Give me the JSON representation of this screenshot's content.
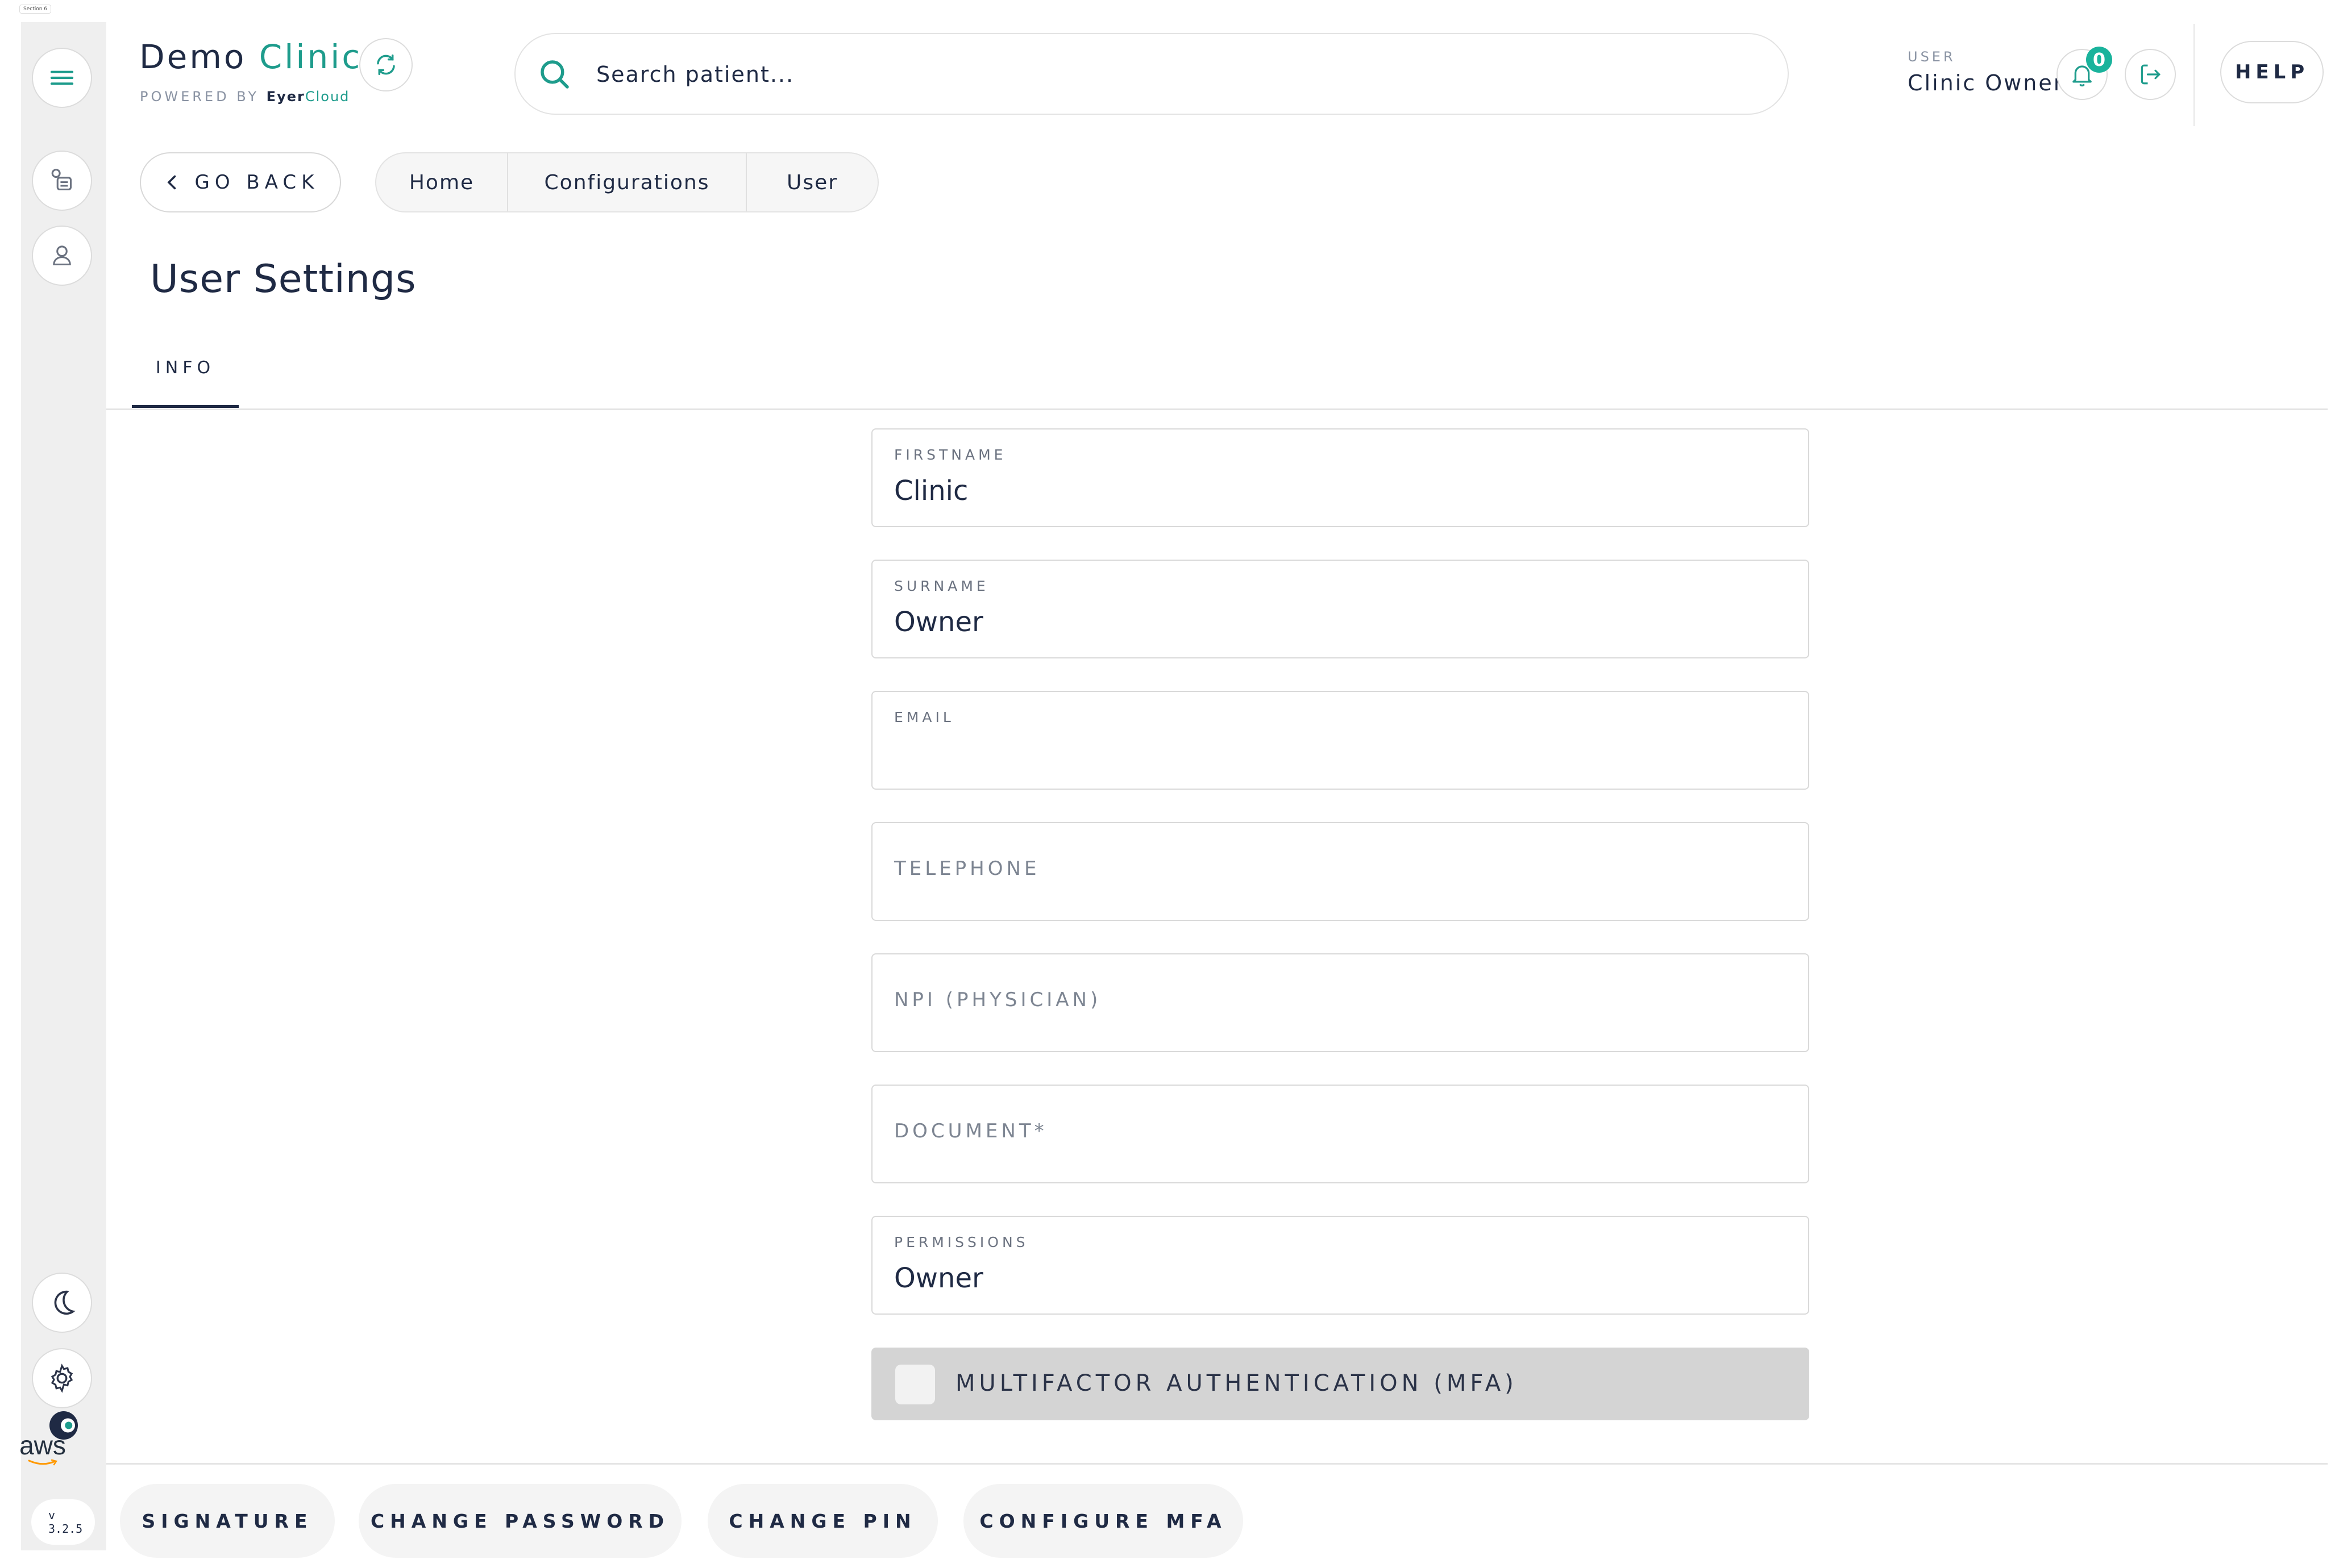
{
  "corner_label": "Section 6",
  "brand": {
    "title_part1": "Demo ",
    "title_part2": "Clinic",
    "powered_by": "POWERED BY",
    "eyer": "Eyer",
    "cloud": "Cloud"
  },
  "search": {
    "placeholder": "Search patient..."
  },
  "user": {
    "label": "USER",
    "name": "Clinic Owner"
  },
  "notifications": {
    "count": "0"
  },
  "help_label": "HELP",
  "nav": {
    "go_back": "GO BACK",
    "breadcrumbs": [
      "Home",
      "Configurations",
      "User"
    ]
  },
  "page_title": "User Settings",
  "tabs": [
    {
      "label": "INFO",
      "active": true
    }
  ],
  "form": {
    "firstname": {
      "label": "FIRSTNAME",
      "value": "Clinic"
    },
    "surname": {
      "label": "SURNAME",
      "value": "Owner"
    },
    "email": {
      "label": "EMAIL",
      "value": ""
    },
    "telephone": {
      "label": "TELEPHONE"
    },
    "npi": {
      "label": "NPI (PHYSICIAN)"
    },
    "document": {
      "label": "DOCUMENT*"
    },
    "permissions": {
      "label": "PERMISSIONS",
      "value": "Owner"
    },
    "mfa": {
      "label": "MULTIFACTOR AUTHENTICATION (MFA)",
      "checked": false
    }
  },
  "bottom_actions": [
    "SIGNATURE",
    "CHANGE PASSWORD",
    "CHANGE PIN",
    "CONFIGURE MFA"
  ],
  "aws_text": "aws",
  "version": {
    "prefix": "v",
    "number": "3.2.5"
  },
  "icons": {
    "menu": "hamburger-menu-icon",
    "patients": "patient-list-icon",
    "profile": "user-profile-icon",
    "theme": "moon-icon",
    "settings": "gear-icon",
    "brand": "eyer-logo-icon",
    "refresh": "refresh-icon",
    "search": "search-icon",
    "bell": "bell-icon",
    "logout": "logout-icon"
  },
  "colors": {
    "accent": "#1e9c8c",
    "badge": "#1ab39c",
    "text": "#1f2a44",
    "sidebar": "#efefef"
  }
}
